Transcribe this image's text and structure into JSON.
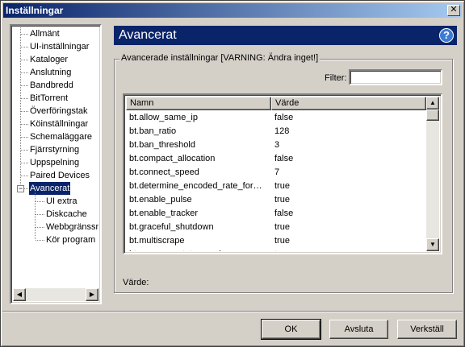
{
  "window": {
    "title": "Inställningar",
    "close_glyph": "✕"
  },
  "tree": {
    "items": [
      {
        "label": "Allmänt"
      },
      {
        "label": "UI-inställningar"
      },
      {
        "label": "Kataloger"
      },
      {
        "label": "Anslutning"
      },
      {
        "label": "Bandbredd"
      },
      {
        "label": "BitTorrent"
      },
      {
        "label": "Överföringstak"
      },
      {
        "label": "Köinställningar"
      },
      {
        "label": "Schemaläggare"
      },
      {
        "label": "Fjärrstyrning"
      },
      {
        "label": "Uppspelning"
      },
      {
        "label": "Paired Devices"
      },
      {
        "label": "Avancerat",
        "selected": true,
        "expanded": true
      },
      {
        "label": "UI extra",
        "child": true
      },
      {
        "label": "Diskcache",
        "child": true
      },
      {
        "label": "Webbgränssnit",
        "child": true
      },
      {
        "label": "Kör program",
        "child": true
      }
    ],
    "expander_glyph": "−",
    "scroll_left_glyph": "◀",
    "scroll_right_glyph": "▶"
  },
  "panel": {
    "title": "Avancerat",
    "help_glyph": "?",
    "group_label": "Avancerade inställningar [VARNING: Ändra inget!]",
    "filter_label": "Filter:",
    "filter_value": "",
    "columns": {
      "name": "Namn",
      "value": "Värde"
    },
    "rows": [
      {
        "name": "bt.allow_same_ip",
        "value": "false"
      },
      {
        "name": "bt.ban_ratio",
        "value": "128"
      },
      {
        "name": "bt.ban_threshold",
        "value": "3"
      },
      {
        "name": "bt.compact_allocation",
        "value": "false"
      },
      {
        "name": "bt.connect_speed",
        "value": "7"
      },
      {
        "name": "bt.determine_encoded_rate_for…",
        "value": "true"
      },
      {
        "name": "bt.enable_pulse",
        "value": "true"
      },
      {
        "name": "bt.enable_tracker",
        "value": "false"
      },
      {
        "name": "bt.graceful_shutdown",
        "value": "true"
      },
      {
        "name": "bt.multiscrape",
        "value": "true"
      },
      {
        "name": "bt.no_connect_to_services",
        "value": "true"
      }
    ],
    "scroll_up_glyph": "▲",
    "scroll_down_glyph": "▼",
    "value_label": "Värde:"
  },
  "buttons": {
    "ok": "OK",
    "cancel": "Avsluta",
    "apply": "Verkställ"
  },
  "colors": {
    "selection": "#0a246a",
    "face": "#d4d0c8",
    "header": "#0a246a"
  }
}
